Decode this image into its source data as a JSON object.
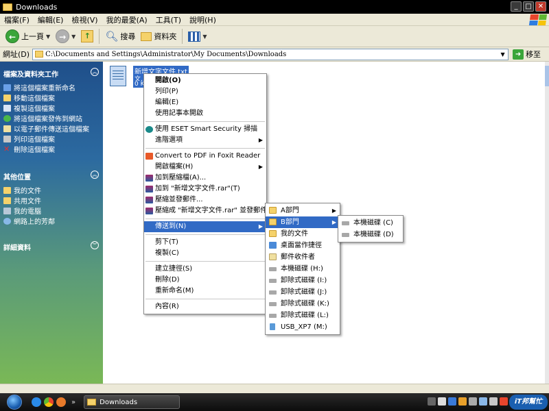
{
  "window": {
    "title": "Downloads"
  },
  "menubar": {
    "items": [
      "檔案(F)",
      "編輯(E)",
      "檢視(V)",
      "我的最愛(A)",
      "工具(T)",
      "說明(H)"
    ]
  },
  "toolbar": {
    "back_label": "上一頁",
    "search_label": "搜尋",
    "folders_label": "資料夾"
  },
  "address": {
    "label": "網址(D)",
    "path": "C:\\Documents and Settings\\Administrator\\My Documents\\Downloads",
    "go_label": "移至"
  },
  "leftpane": {
    "tasks_title": "檔案及資料夾工作",
    "tasks": [
      "將這個檔案重新命名",
      "移動這個檔案",
      "複製這個檔案",
      "將這個檔案發佈到網站",
      "以電子郵件傳送這個檔案",
      "列印這個檔案",
      "刪除這個檔案"
    ],
    "places_title": "其他位置",
    "places": [
      "我的文件",
      "共用文件",
      "我的電腦",
      "網路上的芳鄰"
    ],
    "details_title": "詳細資料"
  },
  "file": {
    "name": "新增文字文件.txt",
    "line2": "文...",
    "line3": "0 KB"
  },
  "context_menu": {
    "open": "開啟(O)",
    "print": "列印(P)",
    "edit": "編輯(E)",
    "open_notepad": "使用記事本開啟",
    "eset": "使用 ESET Smart Security 掃描",
    "advanced": "進階選項",
    "foxit": "Convert to PDF in Foxit Reader",
    "open_with": "開啟檔案(H)",
    "add_archive": "加到壓縮檔(A)...",
    "add_rar": "加到 \"新增文字文件.rar\"(T)",
    "compress_email": "壓縮並發郵件...",
    "compress_rar_email": "壓縮成 \"新增文字文件.rar\" 並發郵件",
    "send_to": "傳送到(N)",
    "cut": "剪下(T)",
    "copy": "複製(C)",
    "shortcut": "建立捷徑(S)",
    "delete": "刪除(D)",
    "rename": "重新命名(M)",
    "properties": "內容(R)"
  },
  "sendto_menu": [
    "A部門",
    "B部門",
    "我的文件",
    "桌面當作捷徑",
    "郵件收件者",
    "本機磁碟 (H:)",
    "卸除式磁碟 (I:)",
    "卸除式磁碟 (J:)",
    "卸除式磁碟 (K:)",
    "卸除式磁碟 (L:)",
    "USB_XP7 (M:)"
  ],
  "b_dept_menu": [
    "本機磁碟 (C)",
    "本機磁碟 (D)"
  ],
  "taskbar": {
    "task_label": "Downloads",
    "brand": "iT邦幫忙"
  },
  "colors": {
    "highlight": "#316ac5",
    "leftpane_top": "#1f4f8a",
    "leftpane_bottom": "#7ab856"
  }
}
